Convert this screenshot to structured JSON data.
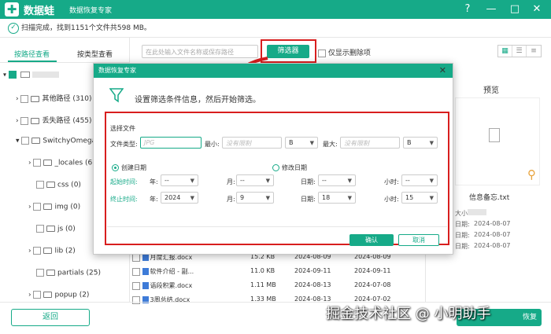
{
  "app": {
    "name": "数据蛙",
    "subtitle": "数据恢复专家",
    "window_controls": [
      "?",
      "—",
      "□",
      "✕"
    ]
  },
  "status": {
    "text": "扫描完成，找到1151个文件共598 MB。"
  },
  "tabs": {
    "path": "按路径查看",
    "type": "按类型查看"
  },
  "toolbar": {
    "search_placeholder": "在此处输入文件名称或保存路径",
    "filter_label": "筛选器",
    "only_deleted": "仅显示删除项"
  },
  "tree": {
    "root": "",
    "items": [
      {
        "label": "其他路径 (310)",
        "indent": 1
      },
      {
        "label": "丢失路径 (455)",
        "indent": 1
      },
      {
        "label": "SwitchyOmega",
        "indent": 1
      },
      {
        "label": "_locales (6)",
        "indent": 2
      },
      {
        "label": "css (0)",
        "indent": 2
      },
      {
        "label": "img (0)",
        "indent": 2
      },
      {
        "label": "js (0)",
        "indent": 2
      },
      {
        "label": "lib (2)",
        "indent": 2
      },
      {
        "label": "partials (25)",
        "indent": 2
      },
      {
        "label": "popup (2)",
        "indent": 2
      }
    ]
  },
  "files": [
    {
      "name": "月度汇报.docx",
      "size": "15.2 KB",
      "date1": "2024-08-09",
      "date2": "2024-08-09"
    },
    {
      "name": "软件介绍 - 副...",
      "size": "11.0 KB",
      "date1": "2024-09-11",
      "date2": "2024-09-11"
    },
    {
      "name": "语段积累.docx",
      "size": "1.11 MB",
      "date1": "2024-08-13",
      "date2": "2024-07-08"
    },
    {
      "name": "3周总结.docx",
      "size": "1.33 MB",
      "date1": "2024-08-13",
      "date2": "2024-07-02"
    }
  ],
  "preview": {
    "title": "预览",
    "filename": "信息备忘.txt",
    "size_label": "大小:",
    "date_rows": [
      {
        "label": "日期:",
        "value": "2024-08-07"
      },
      {
        "label": "日期:",
        "value": "2024-08-07"
      },
      {
        "label": "日期:",
        "value": "2024-08-07"
      }
    ]
  },
  "dialog": {
    "title": "数据恢复专家",
    "heading": "设置筛选条件信息，然后开始筛选。",
    "section": "选择文件",
    "file_type_label": "文件类型:",
    "file_type_placeholder": "JPG",
    "min_label": "最小:",
    "min_placeholder": "没有限制",
    "unit_b": "B",
    "max_label": "最大:",
    "max_placeholder": "没有限制",
    "create_date": "创建日期",
    "modify_date": "修改日期",
    "start_label": "起始时间:",
    "end_label": "终止时间:",
    "year_label": "年:",
    "month_label": "月:",
    "day_label": "日期:",
    "hour_label": "小时:",
    "start": {
      "year": "--",
      "month": "--",
      "day": "--",
      "hour": "--"
    },
    "end": {
      "year": "2024",
      "month": "9",
      "day": "18",
      "hour": "15"
    },
    "ok": "确认",
    "cancel": "取消"
  },
  "bottom": {
    "back": "返回",
    "recover": "恢复"
  },
  "watermark": "掘金技术社区 @ 小明助手"
}
